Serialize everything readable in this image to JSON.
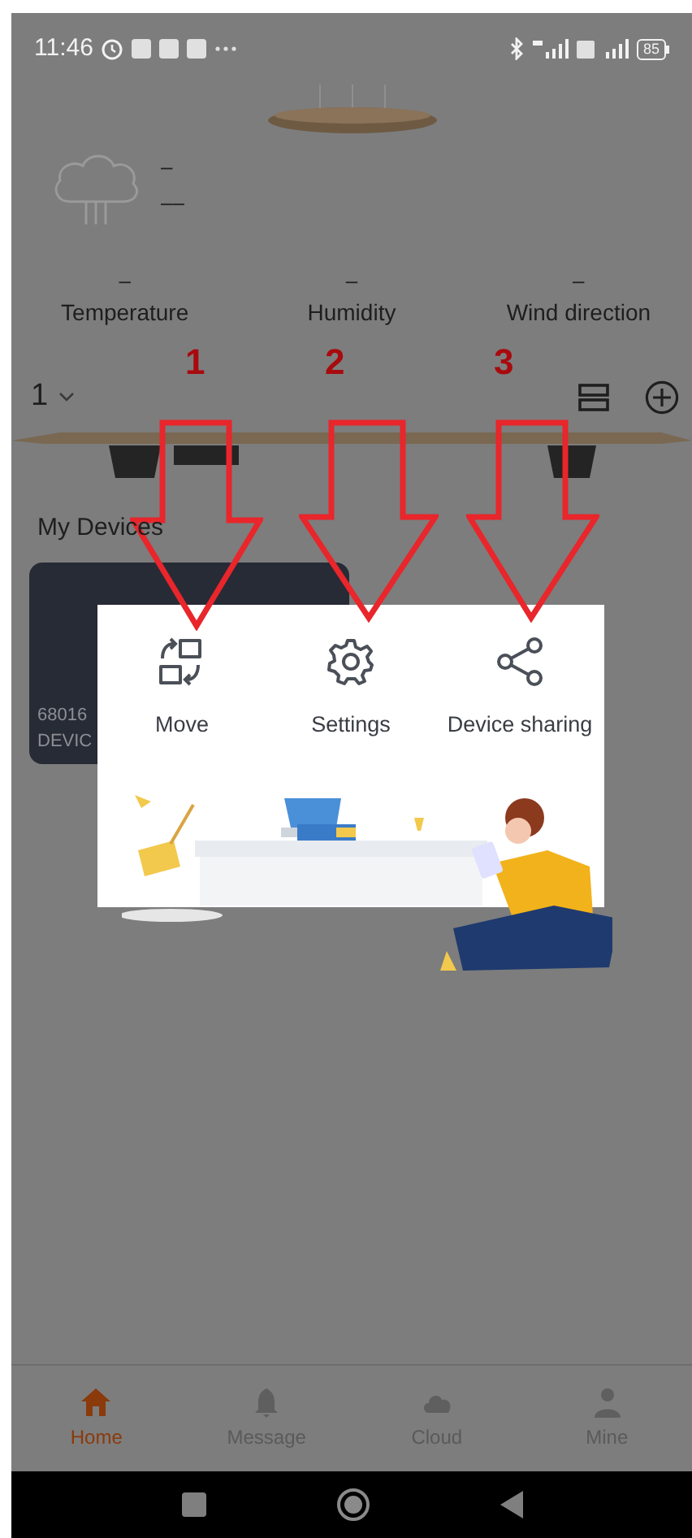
{
  "status_bar": {
    "time": "11:46",
    "battery": "85"
  },
  "weather": {
    "line_1": "–",
    "line_2": "––"
  },
  "stats": [
    {
      "value": "–",
      "label": "Temperature"
    },
    {
      "value": "–",
      "label": "Humidity"
    },
    {
      "value": "–",
      "label": "Wind direction"
    }
  ],
  "home_selector": {
    "label": "1"
  },
  "section_title": "My Devices",
  "device_card": {
    "line_1": "68016",
    "line_2": "DEVIC"
  },
  "popup": {
    "actions": [
      {
        "kind": "move",
        "label": "Move"
      },
      {
        "kind": "settings",
        "label": "Settings"
      },
      {
        "kind": "share",
        "label": "Device sharing"
      }
    ]
  },
  "annotations": [
    {
      "label": "1"
    },
    {
      "label": "2"
    },
    {
      "label": "3"
    }
  ],
  "tab_bar": [
    {
      "kind": "home",
      "label": "Home",
      "selected": true
    },
    {
      "kind": "bell",
      "label": "Message",
      "selected": false
    },
    {
      "kind": "cloud",
      "label": "Cloud",
      "selected": false
    },
    {
      "kind": "person",
      "label": "Mine",
      "selected": false
    }
  ]
}
